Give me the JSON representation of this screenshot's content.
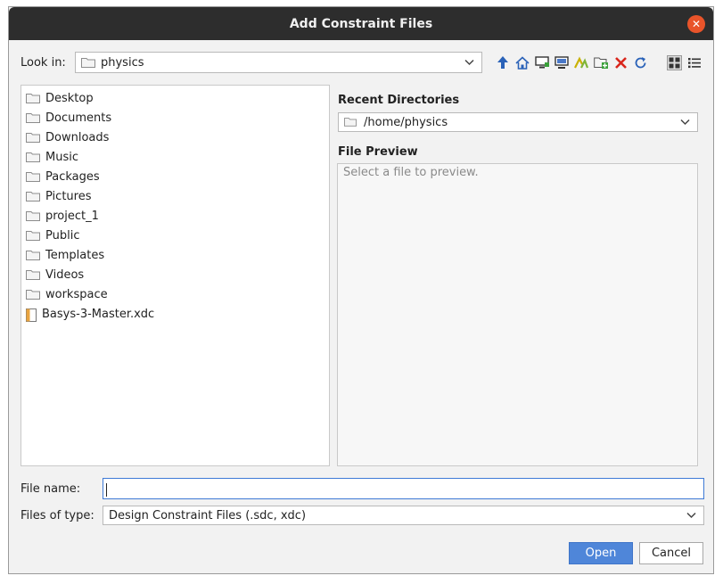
{
  "window": {
    "title": "Add Constraint Files"
  },
  "look_in": {
    "label": "Look in:",
    "value": "physics"
  },
  "toolbar": {
    "icons": [
      "up-folder-icon",
      "home-icon",
      "desktop-icon",
      "computer-icon",
      "vivado-icon",
      "new-folder-icon",
      "delete-icon",
      "refresh-icon",
      "grid-view-icon",
      "list-view-icon"
    ]
  },
  "files": {
    "items": [
      {
        "name": "Desktop",
        "type": "folder"
      },
      {
        "name": "Documents",
        "type": "folder"
      },
      {
        "name": "Downloads",
        "type": "folder"
      },
      {
        "name": "Music",
        "type": "folder"
      },
      {
        "name": "Packages",
        "type": "folder"
      },
      {
        "name": "Pictures",
        "type": "folder"
      },
      {
        "name": "project_1",
        "type": "folder"
      },
      {
        "name": "Public",
        "type": "folder"
      },
      {
        "name": "Templates",
        "type": "folder"
      },
      {
        "name": "Videos",
        "type": "folder"
      },
      {
        "name": "workspace",
        "type": "folder"
      },
      {
        "name": "Basys-3-Master.xdc",
        "type": "file"
      }
    ]
  },
  "recent": {
    "title": "Recent Directories",
    "value": "/home/physics"
  },
  "preview": {
    "title": "File Preview",
    "placeholder": "Select a file to preview."
  },
  "file_name": {
    "label": "File name:",
    "value": ""
  },
  "file_type": {
    "label": "Files of type:",
    "value": "Design Constraint Files (.sdc, xdc)"
  },
  "buttons": {
    "open": "Open",
    "cancel": "Cancel"
  },
  "colors": {
    "primary": "#4f86d9",
    "close": "#e9542a",
    "titlebar": "#2d2d2d",
    "delete": "#d9261c",
    "focus": "#3f7ad6"
  }
}
